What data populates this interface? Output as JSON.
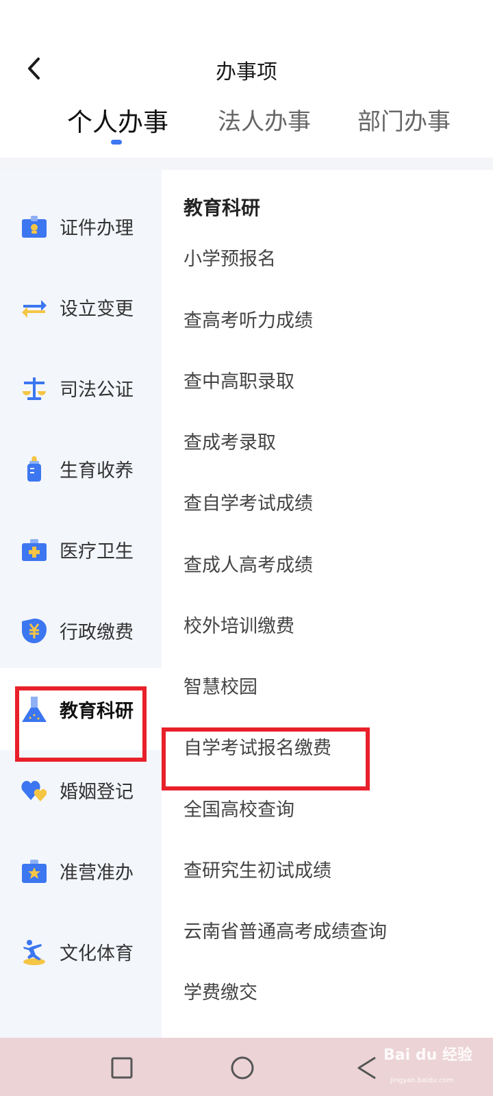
{
  "header": {
    "title": "办事项",
    "tabs": [
      {
        "label": "个人办事",
        "active": true
      },
      {
        "label": "法人办事",
        "active": false
      },
      {
        "label": "部门办事",
        "active": false
      }
    ]
  },
  "sidebar": {
    "items": [
      {
        "label": "证件办理",
        "icon": "id-card-icon"
      },
      {
        "label": "设立变更",
        "icon": "swap-arrows-icon"
      },
      {
        "label": "司法公证",
        "icon": "scales-icon"
      },
      {
        "label": "生育收养",
        "icon": "baby-bottle-icon"
      },
      {
        "label": "医疗卫生",
        "icon": "medical-kit-icon"
      },
      {
        "label": "行政缴费",
        "icon": "yuan-shield-icon"
      },
      {
        "label": "教育科研",
        "icon": "flask-icon",
        "active": true
      },
      {
        "label": "婚姻登记",
        "icon": "hearts-icon"
      },
      {
        "label": "准营准办",
        "icon": "star-briefcase-icon"
      },
      {
        "label": "文化体育",
        "icon": "athlete-icon"
      }
    ]
  },
  "content": {
    "section_title": "教育科研",
    "items": [
      "小学预报名",
      "查高考听力成绩",
      "查中高职录取",
      "查成考录取",
      "查自学考试成绩",
      "查成人高考成绩",
      "校外培训缴费",
      "智慧校园",
      "自学考试报名缴费",
      "全国高校查询",
      "查研究生初试成绩",
      "云南省普通高考成绩查询",
      "学费缴交"
    ]
  },
  "navbar": {
    "buttons": [
      "recent-apps-icon",
      "home-icon",
      "back-triangle-icon"
    ]
  },
  "watermark": {
    "brand": "Bai du 经验",
    "url": "jingyan.baidu.com"
  },
  "colors": {
    "accent": "#3c76f0",
    "highlight": "#e8202a",
    "sidebar_bg": "#f3f6fb",
    "icon_blue": "#3c76f0",
    "icon_yellow": "#f5c544"
  }
}
